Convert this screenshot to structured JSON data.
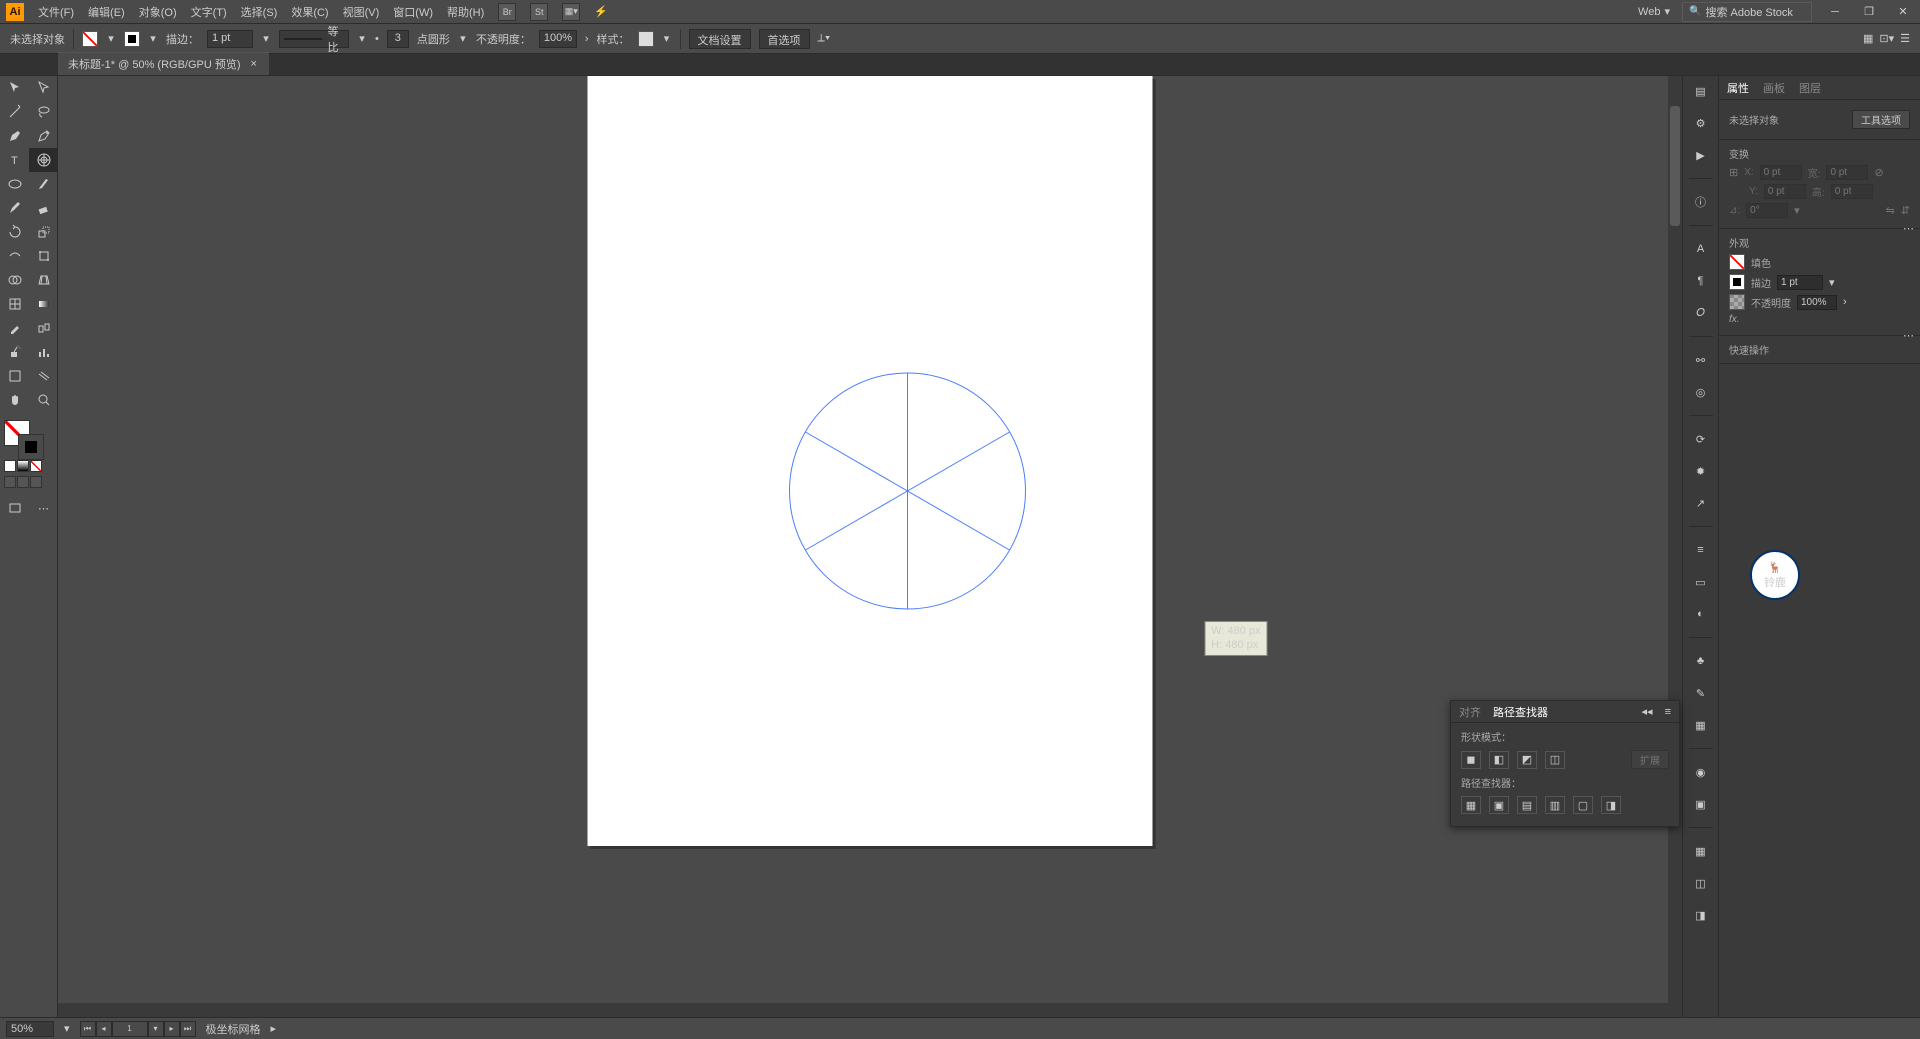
{
  "app": {
    "logo": "Ai"
  },
  "menu": {
    "items": [
      "文件(F)",
      "编辑(E)",
      "对象(O)",
      "文字(T)",
      "选择(S)",
      "效果(C)",
      "视图(V)",
      "窗口(W)",
      "帮助(H)"
    ],
    "workspace": "Web",
    "search_placeholder": "搜索 Adobe Stock"
  },
  "controlbar": {
    "selection": "未选择对象",
    "stroke_label": "描边：",
    "stroke_weight": "1 pt",
    "profile_label": "等比",
    "shape_points": "3",
    "shape_type": "点圆形",
    "opacity_label": "不透明度：",
    "opacity_value": "100%",
    "style_label": "样式：",
    "doc_setup": "文档设置",
    "prefs": "首选项"
  },
  "doctab": {
    "title": "未标题-1* @ 50% (RGB/GPU 预览)",
    "close": "×"
  },
  "artboard": {
    "tooltip_w": "W: 480 px",
    "tooltip_h": "H: 480 px"
  },
  "status": {
    "zoom": "50%",
    "artboard_nav": "1",
    "grid_label": "极坐标网格"
  },
  "properties": {
    "tabs": [
      "属性",
      "画板",
      "图层"
    ],
    "no_sel": "未选择对象",
    "tool_opts": "工具选项",
    "transform_header": "变换",
    "x_label": "X:",
    "x_val": "0 pt",
    "y_label": "Y:",
    "y_val": "0 pt",
    "w_label": "宽:",
    "w_val": "0 pt",
    "h_label": "高:",
    "h_val": "0 pt",
    "angle_label": "⊿:",
    "angle_val": "0°",
    "appearance_header": "外观",
    "fill_label": "填色",
    "stroke_label": "描边",
    "stroke_val": "1 pt",
    "opacity_label": "不透明度",
    "opacity_val": "100%",
    "fx": "fx.",
    "quick_header": "快速操作"
  },
  "floatpanel": {
    "tab1": "对齐",
    "tab2": "路径查找器",
    "shape_mode": "形状模式：",
    "expand": "扩展",
    "pathfinder": "路径查找器："
  },
  "watermark": {
    "top": "🦌",
    "bottom": "铃鹿"
  }
}
